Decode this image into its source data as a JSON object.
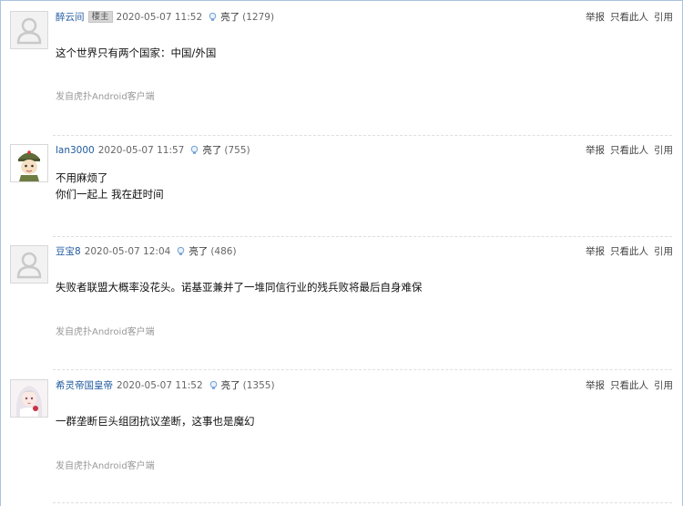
{
  "posts": [
    {
      "user": "醉云间",
      "badge": "楼主",
      "time": "2020-05-07 11:52",
      "light_label": "亮了",
      "light_count": "(1279)",
      "lines": [
        "这个世界只有两个国家：中国/外国"
      ],
      "source": "发自虎扑Android客户端",
      "avatar": "default-avatar-icon"
    },
    {
      "user": "lan3000",
      "time": "2020-05-07 11:57",
      "light_label": "亮了",
      "light_count": "(755)",
      "lines": [
        "不用麻烦了",
        "你们一起上 我在赶时间"
      ],
      "avatar": "soldier-avatar-icon"
    },
    {
      "user": "豆宝8",
      "time": "2020-05-07 12:04",
      "light_label": "亮了",
      "light_count": "(486)",
      "lines": [
        "失败者联盟大概率没花头。诺基亚兼并了一堆同信行业的残兵败将最后自身难保"
      ],
      "source": "发自虎扑Android客户端",
      "avatar": "default-avatar-icon"
    },
    {
      "user": "希灵帝国皇帝",
      "time": "2020-05-07 11:52",
      "light_label": "亮了",
      "light_count": "(1355)",
      "lines": [
        "一群垄断巨头组团抗议垄断，这事也是魔幻"
      ],
      "source": "发自虎扑Android客户端",
      "avatar": "anime-girl-avatar-icon"
    }
  ],
  "actions": {
    "report": "举报",
    "only_this": "只看此人",
    "quote": "引用"
  },
  "colors": {
    "username": "#1f5a9e",
    "frame": "#a9c3dd"
  }
}
